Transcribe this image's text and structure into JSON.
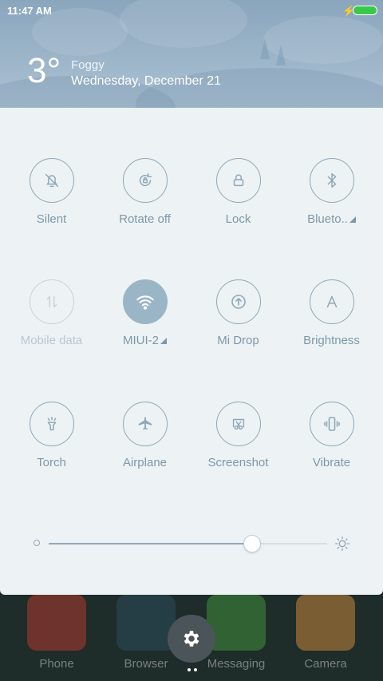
{
  "status_bar": {
    "time": "11:47 AM",
    "charging": true,
    "battery_color": "#39c84a"
  },
  "weather": {
    "temperature": "3°",
    "condition": "Foggy",
    "date": "Wednesday, December 21"
  },
  "tiles": [
    {
      "label": "Silent",
      "icon": "bell-off-icon",
      "state": "off"
    },
    {
      "label": "Rotate off",
      "icon": "rotate-lock-icon",
      "state": "off"
    },
    {
      "label": "Lock",
      "icon": "lock-icon",
      "state": "off"
    },
    {
      "label": "Blueto..",
      "icon": "bluetooth-icon",
      "state": "off",
      "expandable": true
    },
    {
      "label": "Mobile data",
      "icon": "mobile-data-icon",
      "state": "disabled"
    },
    {
      "label": "MIUI-2",
      "icon": "wifi-icon",
      "state": "on",
      "expandable": true
    },
    {
      "label": "Mi Drop",
      "icon": "mi-drop-icon",
      "state": "off"
    },
    {
      "label": "Brightness",
      "icon": "auto-brightness-icon",
      "state": "off"
    },
    {
      "label": "Torch",
      "icon": "torch-icon",
      "state": "off"
    },
    {
      "label": "Airplane",
      "icon": "airplane-icon",
      "state": "off"
    },
    {
      "label": "Screenshot",
      "icon": "screenshot-icon",
      "state": "off"
    },
    {
      "label": "Vibrate",
      "icon": "vibrate-icon",
      "state": "off"
    }
  ],
  "brightness": {
    "level_percent": 73
  },
  "home_apps": [
    {
      "label": "Phone",
      "color": "#b03a2e"
    },
    {
      "label": "Browser",
      "color": "#2c4c5a"
    },
    {
      "label": "Messaging",
      "color": "#3f8f3a"
    },
    {
      "label": "Camera",
      "color": "#c9863a"
    }
  ],
  "accent": "#9ab6c6"
}
